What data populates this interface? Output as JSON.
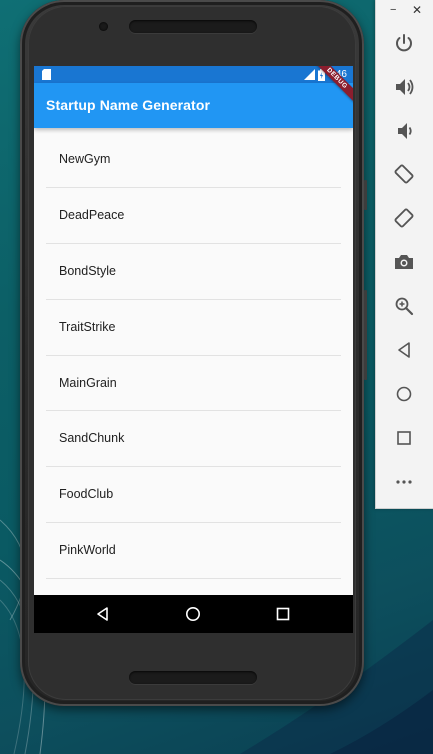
{
  "app": {
    "title": "Startup Name Generator",
    "debug_banner": "DEBUG",
    "status_time": "3:46"
  },
  "names": [
    "NewGym",
    "DeadPeace",
    "BondStyle",
    "TraitStrike",
    "MainGrain",
    "SandChunk",
    "FoodClub",
    "PinkWorld"
  ],
  "colors": {
    "app_bar": "#2196f3",
    "status_bar": "#1976d2",
    "list_background": "#fafafa",
    "debug_banner": "#8b1e2e"
  },
  "emulator_toolbar": {
    "window_controls": [
      "minimize-icon",
      "close-icon"
    ],
    "buttons": [
      "power-icon",
      "volume-up-icon",
      "volume-down-icon",
      "rotate-left-icon",
      "rotate-right-icon",
      "camera-icon",
      "zoom-icon",
      "back-icon",
      "home-icon",
      "overview-icon",
      "more-icon"
    ]
  },
  "nav_bar": [
    "back-icon",
    "home-icon",
    "overview-icon"
  ]
}
